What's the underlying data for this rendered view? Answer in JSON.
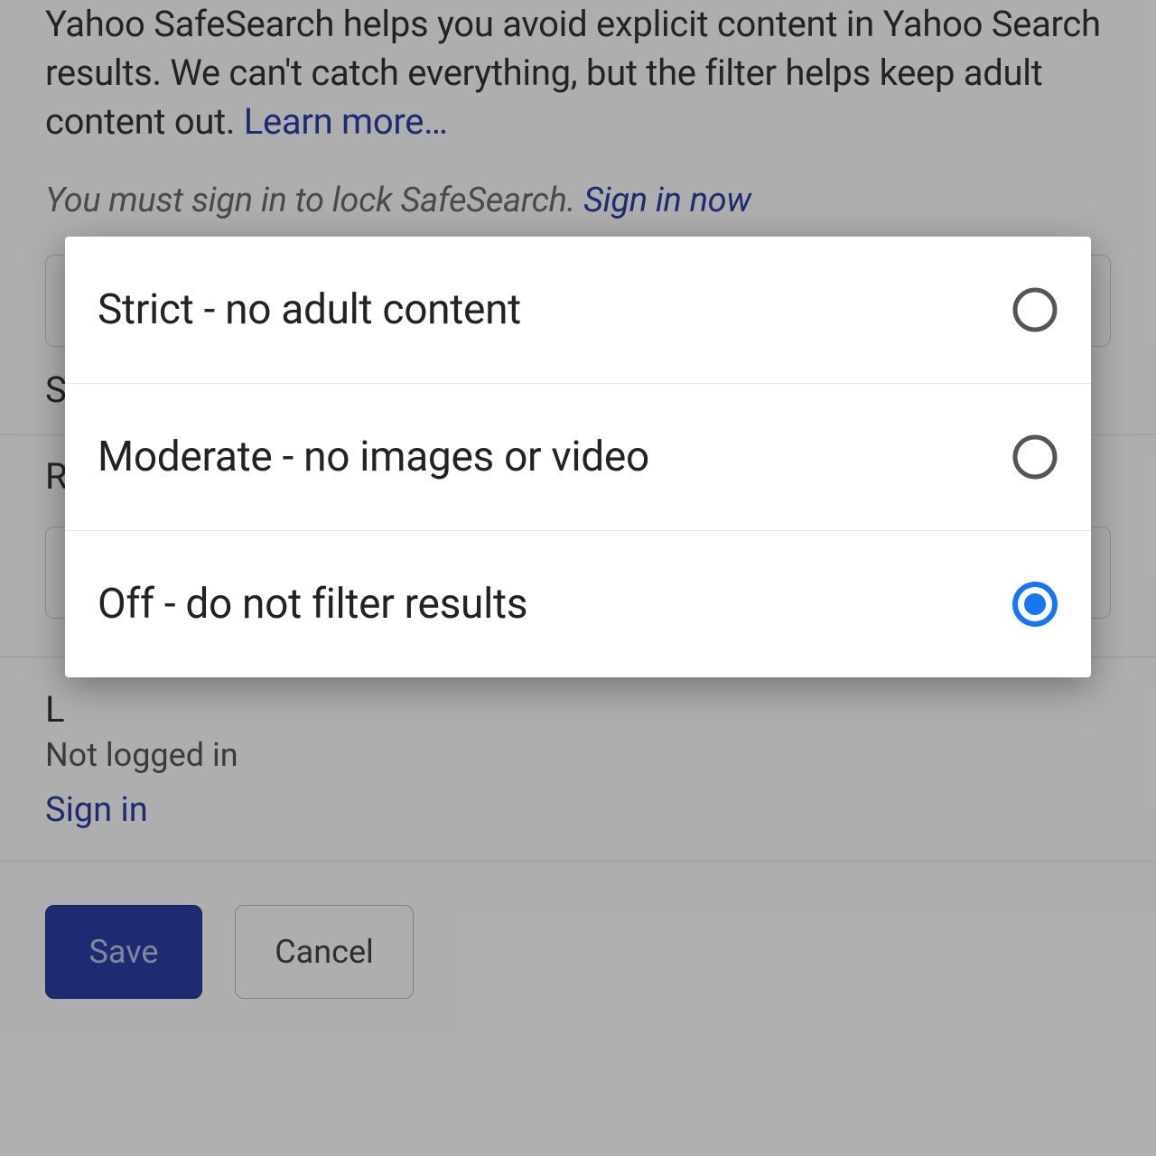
{
  "safesearch": {
    "description": "Yahoo SafeSearch helps you avoid explicit content in Yahoo Search results. We can't catch everything, but the filter helps keep adult content out. ",
    "learn_more": "Learn more…",
    "signin_note_prefix": "You must sign in to lock SafeSearch. ",
    "signin_now": "Sign in now"
  },
  "section_s_label": "S",
  "section_r_label": "R",
  "login": {
    "heading_visible": "L",
    "status": "Not logged in",
    "signin": "Sign in"
  },
  "buttons": {
    "save": "Save",
    "cancel": "Cancel"
  },
  "modal": {
    "options": [
      {
        "label": "Strict - no adult content",
        "selected": false
      },
      {
        "label": "Moderate - no images or video",
        "selected": false
      },
      {
        "label": "Off - do not filter results",
        "selected": true
      }
    ]
  },
  "colors": {
    "link": "#2b3ea5",
    "primary_button": "#2b3ea5",
    "radio_selected": "#1976f2"
  }
}
